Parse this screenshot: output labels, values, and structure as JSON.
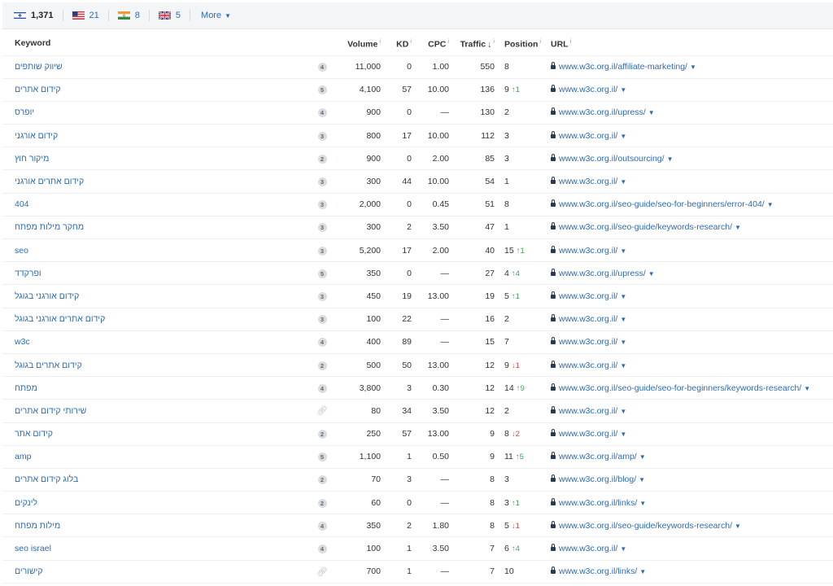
{
  "countries": [
    {
      "code": "il",
      "count": "1,371",
      "active": true
    },
    {
      "code": "us",
      "count": "21"
    },
    {
      "code": "in",
      "count": "8"
    },
    {
      "code": "gb",
      "count": "5"
    }
  ],
  "more_label": "More",
  "columns": {
    "keyword": "Keyword",
    "volume": "Volume",
    "kd": "KD",
    "cpc": "CPC",
    "traffic": "Traffic",
    "position": "Position",
    "url": "URL",
    "info_glyph": "i",
    "sort_glyph": "↓"
  },
  "rows": [
    {
      "keyword": "שיווק שותפים",
      "serp": "4",
      "volume": "11,000",
      "kd": "0",
      "cpc": "1.00",
      "traffic": "550",
      "position": "8",
      "change": "",
      "dir": "",
      "url": "www.w3c.org.il/affiliate-marketing/"
    },
    {
      "keyword": "קידום אתרים",
      "serp": "5",
      "volume": "4,100",
      "kd": "57",
      "cpc": "10.00",
      "traffic": "136",
      "position": "9",
      "change": "1",
      "dir": "up",
      "url": "www.w3c.org.il/"
    },
    {
      "keyword": "יופרס",
      "serp": "4",
      "volume": "900",
      "kd": "0",
      "cpc": "—",
      "traffic": "130",
      "position": "2",
      "change": "",
      "dir": "",
      "url": "www.w3c.org.il/upress/"
    },
    {
      "keyword": "קידום אורגני",
      "serp": "3",
      "volume": "800",
      "kd": "17",
      "cpc": "10.00",
      "traffic": "112",
      "position": "3",
      "change": "",
      "dir": "",
      "url": "www.w3c.org.il/"
    },
    {
      "keyword": "מיקור חוץ",
      "serp": "2",
      "volume": "900",
      "kd": "0",
      "cpc": "2.00",
      "traffic": "85",
      "position": "3",
      "change": "",
      "dir": "",
      "url": "www.w3c.org.il/outsourcing/"
    },
    {
      "keyword": "קידום אתרים אורגני",
      "serp": "3",
      "volume": "300",
      "kd": "44",
      "cpc": "10.00",
      "traffic": "54",
      "position": "1",
      "change": "",
      "dir": "",
      "url": "www.w3c.org.il/"
    },
    {
      "keyword": "404",
      "serp": "3",
      "volume": "2,000",
      "kd": "0",
      "cpc": "0.45",
      "traffic": "51",
      "position": "8",
      "change": "",
      "dir": "",
      "url": "www.w3c.org.il/seo-guide/seo-for-beginners/error-404/"
    },
    {
      "keyword": "מחקר מילות מפתח",
      "serp": "3",
      "volume": "300",
      "kd": "2",
      "cpc": "3.50",
      "traffic": "47",
      "position": "1",
      "change": "",
      "dir": "",
      "url": "www.w3c.org.il/seo-guide/keywords-research/"
    },
    {
      "keyword": "seo",
      "serp": "3",
      "volume": "5,200",
      "kd": "17",
      "cpc": "2.00",
      "traffic": "40",
      "position": "15",
      "change": "1",
      "dir": "up",
      "url": "www.w3c.org.il/"
    },
    {
      "keyword": "ופרקדד",
      "serp": "5",
      "volume": "350",
      "kd": "0",
      "cpc": "—",
      "traffic": "27",
      "position": "4",
      "change": "4",
      "dir": "up",
      "url": "www.w3c.org.il/upress/"
    },
    {
      "keyword": "קידום אורגני בגוגל",
      "serp": "3",
      "volume": "450",
      "kd": "19",
      "cpc": "13.00",
      "traffic": "19",
      "position": "5",
      "change": "1",
      "dir": "up",
      "url": "www.w3c.org.il/"
    },
    {
      "keyword": "קידום אתרים אורגני בגוגל",
      "serp": "3",
      "volume": "100",
      "kd": "22",
      "cpc": "—",
      "traffic": "16",
      "position": "2",
      "change": "",
      "dir": "",
      "url": "www.w3c.org.il/"
    },
    {
      "keyword": "w3c",
      "serp": "4",
      "volume": "400",
      "kd": "89",
      "cpc": "—",
      "traffic": "15",
      "position": "7",
      "change": "",
      "dir": "",
      "url": "www.w3c.org.il/"
    },
    {
      "keyword": "קידום אתרים בגוגל",
      "serp": "2",
      "volume": "500",
      "kd": "50",
      "cpc": "13.00",
      "traffic": "12",
      "position": "9",
      "change": "1",
      "dir": "down",
      "url": "www.w3c.org.il/"
    },
    {
      "keyword": "מפתח",
      "serp": "4",
      "volume": "3,800",
      "kd": "3",
      "cpc": "0.30",
      "traffic": "12",
      "position": "14",
      "change": "9",
      "dir": "up",
      "url": "www.w3c.org.il/seo-guide/seo-for-beginners/keywords-research/"
    },
    {
      "keyword": "שירותי קידום אתרים",
      "serp": "link",
      "volume": "80",
      "kd": "34",
      "cpc": "3.50",
      "traffic": "12",
      "position": "2",
      "change": "",
      "dir": "",
      "url": "www.w3c.org.il/"
    },
    {
      "keyword": "קידום אתר",
      "serp": "2",
      "volume": "250",
      "kd": "57",
      "cpc": "13.00",
      "traffic": "9",
      "position": "8",
      "change": "2",
      "dir": "down",
      "url": "www.w3c.org.il/"
    },
    {
      "keyword": "amp",
      "serp": "5",
      "volume": "1,100",
      "kd": "1",
      "cpc": "0.50",
      "traffic": "9",
      "position": "11",
      "change": "5",
      "dir": "up",
      "url": "www.w3c.org.il/amp/"
    },
    {
      "keyword": "בלוג קידום אתרים",
      "serp": "2",
      "volume": "70",
      "kd": "3",
      "cpc": "—",
      "traffic": "8",
      "position": "3",
      "change": "",
      "dir": "",
      "url": "www.w3c.org.il/blog/"
    },
    {
      "keyword": "לינקים",
      "serp": "2",
      "volume": "60",
      "kd": "0",
      "cpc": "—",
      "traffic": "8",
      "position": "3",
      "change": "1",
      "dir": "up",
      "url": "www.w3c.org.il/links/"
    },
    {
      "keyword": "מילות מפתח",
      "serp": "4",
      "volume": "350",
      "kd": "2",
      "cpc": "1.80",
      "traffic": "8",
      "position": "5",
      "change": "1",
      "dir": "down",
      "url": "www.w3c.org.il/seo-guide/keywords-research/"
    },
    {
      "keyword": "seo israel",
      "serp": "4",
      "volume": "100",
      "kd": "1",
      "cpc": "3.50",
      "traffic": "7",
      "position": "6",
      "change": "4",
      "dir": "up",
      "url": "www.w3c.org.il/"
    },
    {
      "keyword": "קישורים",
      "serp": "link",
      "volume": "700",
      "kd": "1",
      "cpc": "—",
      "traffic": "7",
      "position": "10",
      "change": "",
      "dir": "",
      "url": "www.w3c.org.il/links/"
    }
  ]
}
